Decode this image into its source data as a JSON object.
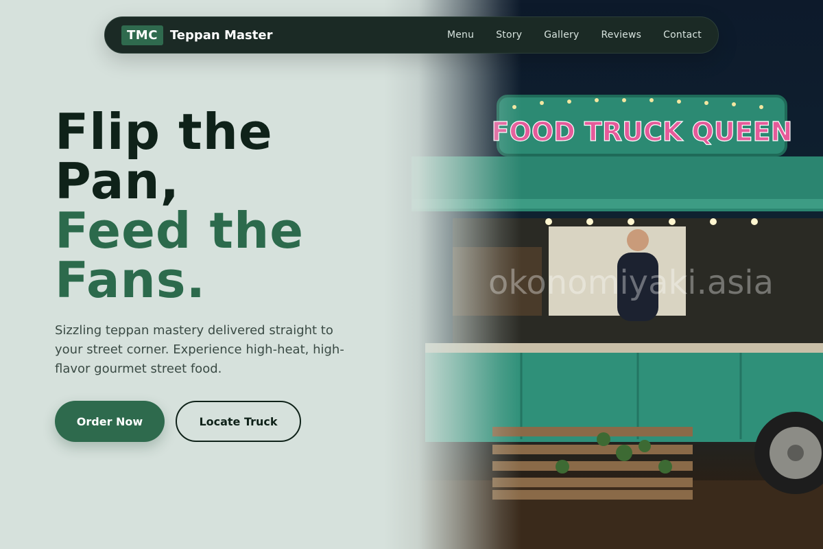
{
  "nav": {
    "logo_badge": "TMC",
    "brand": "Teppan Master",
    "links": [
      "Menu",
      "Story",
      "Gallery",
      "Reviews",
      "Contact"
    ]
  },
  "hero": {
    "title_line1": "Flip the",
    "title_line2": "Pan,",
    "title_line3": "Feed the",
    "title_line4": "Fans.",
    "subtitle": "Sizzling teppan mastery delivered straight to your street corner. Experience high-heat, high-flavor gourmet street food.",
    "primary_button": "Order Now",
    "secondary_button": "Locate Truck"
  },
  "photo": {
    "sign_text": "FOOD TRUCK QUEEN",
    "watermark": "okonomiyaki.asia"
  },
  "colors": {
    "accent": "#2c6a4c",
    "dark": "#0f2219",
    "nav_bg": "#1b2a25",
    "page_bg": "#d6e1dc",
    "truck": "#2f8a73"
  }
}
